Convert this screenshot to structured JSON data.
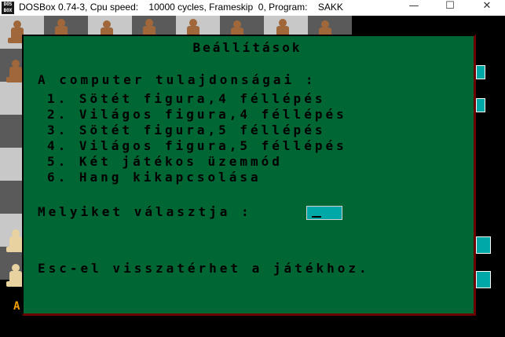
{
  "window": {
    "title": "DOSBox 0.74-3, Cpu speed:    10000 cycles, Frameskip  0, Program:    SAKK",
    "icon_label": "DOS BOX",
    "buttons": {
      "minimize": "—",
      "maximize": "☐",
      "close": "✕"
    }
  },
  "screen": {
    "side_letter": "A"
  },
  "dialog": {
    "title": "Beállítások",
    "heading": "A computer tulajdonságai :",
    "options": [
      "1. Sötét figura,4 féllépés",
      "2. Világos figura,4 féllépés",
      "3. Sötét figura,5 féllépés",
      "4. Világos figura,5 féllépés",
      "5. Két játékos üzemmód",
      "6. Hang kikapcsolása"
    ],
    "prompt": "Melyiket választja :",
    "input_value": "",
    "footer": "Esc-el visszatérhet a játékhoz."
  },
  "colors": {
    "dialog_bg": "#006633",
    "input_bg": "#00a8a8",
    "board_light": "#c8c8c8",
    "board_dark": "#5a5a5a"
  }
}
